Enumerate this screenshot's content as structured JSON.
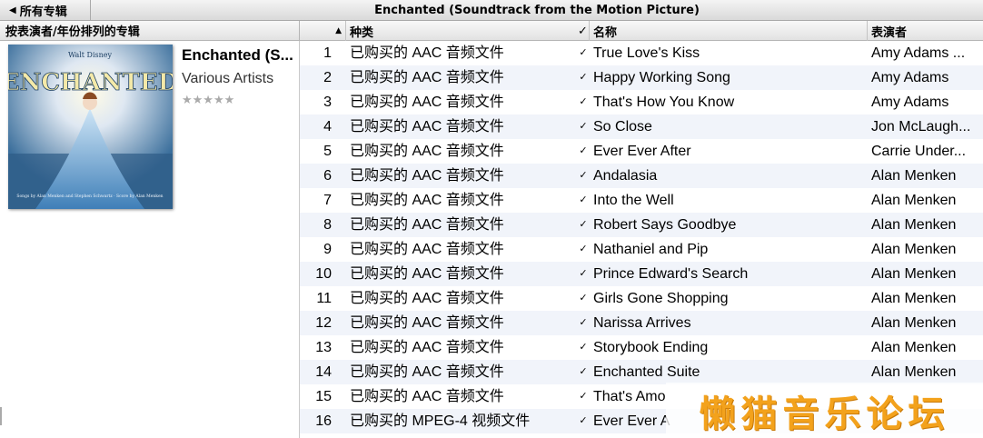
{
  "nav": {
    "back_label": "所有专辑",
    "album_title": "Enchanted (Soundtrack from the Motion Picture)"
  },
  "left": {
    "header": "按表演者/年份排列的专辑",
    "album_name": "Enchanted (S...",
    "artist": "Various Artists",
    "rating": "★★★★★",
    "cover_logo": "Walt Disney",
    "cover_title": "ENCHANTED",
    "cover_credits": "Songs by Alan Menken and Stephen Schwartz · Score by Alan Menken"
  },
  "columns": {
    "num": "",
    "kind": "种类",
    "check": "✓",
    "name": "名称",
    "artist": "表演者"
  },
  "tracks": [
    {
      "num": "1",
      "kind": "已购买的 AAC 音频文件",
      "check": "✓",
      "name": "True Love's Kiss",
      "artist": "Amy Adams ..."
    },
    {
      "num": "2",
      "kind": "已购买的 AAC 音频文件",
      "check": "✓",
      "name": "Happy Working Song",
      "artist": "Amy Adams"
    },
    {
      "num": "3",
      "kind": "已购买的 AAC 音频文件",
      "check": "✓",
      "name": "That's How You Know",
      "artist": "Amy Adams"
    },
    {
      "num": "4",
      "kind": "已购买的 AAC 音频文件",
      "check": "✓",
      "name": "So Close",
      "artist": "Jon McLaugh..."
    },
    {
      "num": "5",
      "kind": "已购买的 AAC 音频文件",
      "check": "✓",
      "name": "Ever Ever After",
      "artist": "Carrie Under..."
    },
    {
      "num": "6",
      "kind": "已购买的 AAC 音频文件",
      "check": "✓",
      "name": "Andalasia",
      "artist": "Alan Menken"
    },
    {
      "num": "7",
      "kind": "已购买的 AAC 音频文件",
      "check": "✓",
      "name": "Into the Well",
      "artist": "Alan Menken"
    },
    {
      "num": "8",
      "kind": "已购买的 AAC 音频文件",
      "check": "✓",
      "name": "Robert Says Goodbye",
      "artist": "Alan Menken"
    },
    {
      "num": "9",
      "kind": "已购买的 AAC 音频文件",
      "check": "✓",
      "name": "Nathaniel and Pip",
      "artist": "Alan Menken"
    },
    {
      "num": "10",
      "kind": "已购买的 AAC 音频文件",
      "check": "✓",
      "name": "Prince Edward's Search",
      "artist": "Alan Menken"
    },
    {
      "num": "11",
      "kind": "已购买的 AAC 音频文件",
      "check": "✓",
      "name": "Girls Gone Shopping",
      "artist": "Alan Menken"
    },
    {
      "num": "12",
      "kind": "已购买的 AAC 音频文件",
      "check": "✓",
      "name": "Narissa Arrives",
      "artist": "Alan Menken"
    },
    {
      "num": "13",
      "kind": "已购买的 AAC 音频文件",
      "check": "✓",
      "name": "Storybook Ending",
      "artist": "Alan Menken"
    },
    {
      "num": "14",
      "kind": "已购买的 AAC 音频文件",
      "check": "✓",
      "name": "Enchanted Suite",
      "artist": "Alan Menken"
    },
    {
      "num": "15",
      "kind": "已购买的 AAC 音频文件",
      "check": "✓",
      "name": "That's Amo",
      "artist": ""
    },
    {
      "num": "16",
      "kind": "已购买的 MPEG-4 视频文件",
      "check": "✓",
      "name": "Ever Ever A",
      "artist": ""
    }
  ],
  "watermark": "懒猫音乐论坛",
  "colors": {
    "row_alt": "#f1f4fa",
    "watermark": "#f3a21c"
  }
}
